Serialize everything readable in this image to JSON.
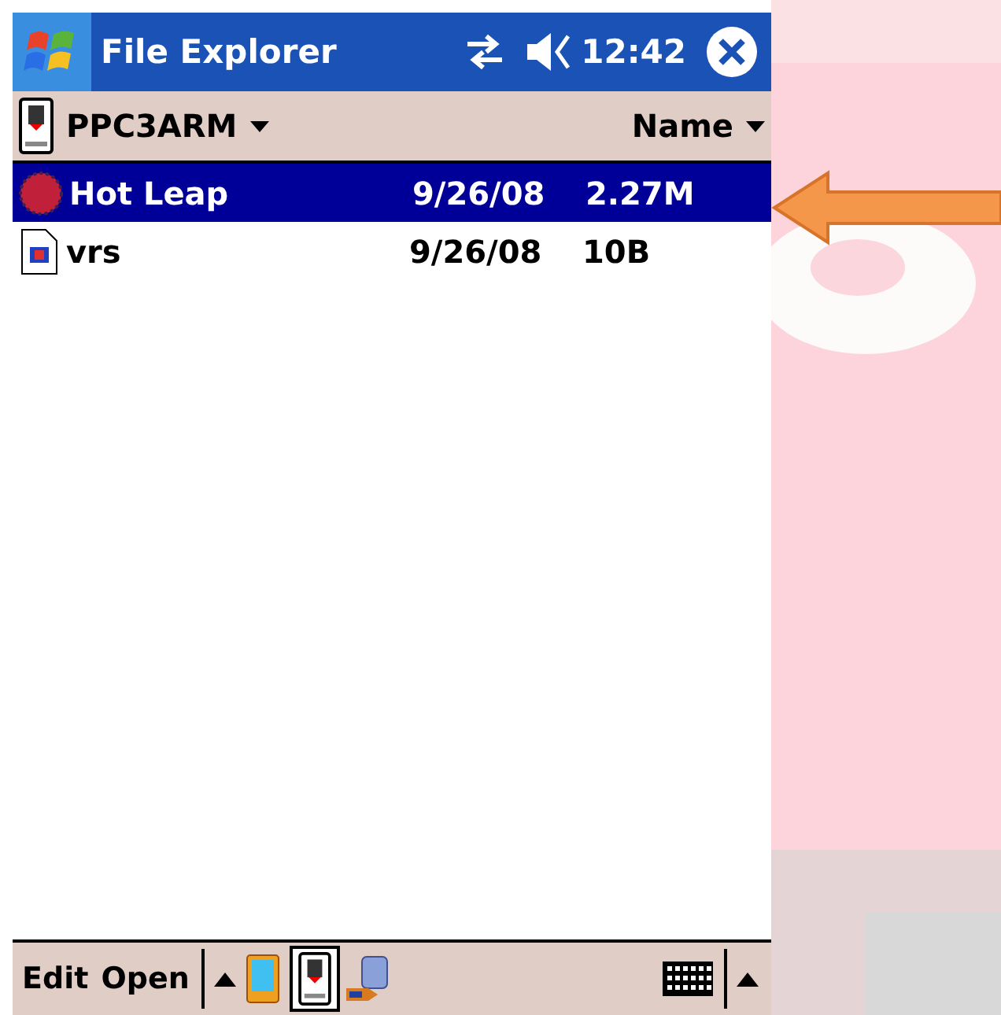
{
  "title_bar": {
    "title": "File Explorer",
    "time": "12:42"
  },
  "location_bar": {
    "folder": "PPC3ARM",
    "sort": "Name"
  },
  "files": [
    {
      "name": "Hot Leap",
      "date": "9/26/08",
      "size": "2.27M",
      "selected": true,
      "kind": "game"
    },
    {
      "name": "vrs",
      "date": "9/26/08",
      "size": "10B",
      "selected": false,
      "kind": "file"
    }
  ],
  "menu_bar": {
    "items": [
      "Edit",
      "Open"
    ]
  }
}
